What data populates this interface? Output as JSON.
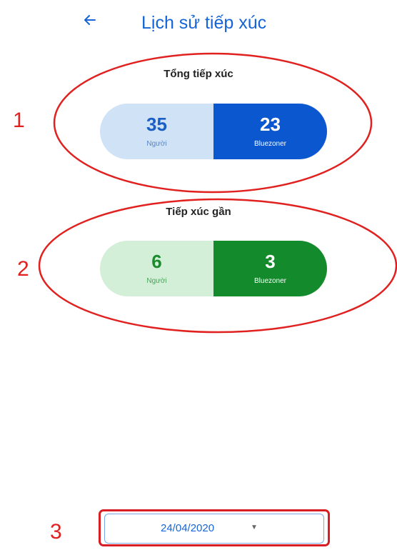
{
  "header": {
    "title": "Lịch sử tiếp xúc",
    "back_icon": "arrow-left-icon"
  },
  "total": {
    "label": "Tổng tiếp xúc",
    "people_count": "35",
    "people_label": "Người",
    "bluezoner_count": "23",
    "bluezoner_label": "Bluezoner"
  },
  "near": {
    "label": "Tiếp xúc gần",
    "people_count": "6",
    "people_label": "Người",
    "bluezoner_count": "3",
    "bluezoner_label": "Bluezoner"
  },
  "date_picker": {
    "value": "24/04/2020",
    "icon": "caret-down-icon"
  },
  "annotations": {
    "one": "1",
    "two": "2",
    "three": "3"
  },
  "colors": {
    "primary_blue": "#1565d8",
    "light_blue": "#cfe2f6",
    "primary_green": "#138a2c",
    "light_green": "#d3efd7",
    "annotation_red": "#e0211f"
  }
}
